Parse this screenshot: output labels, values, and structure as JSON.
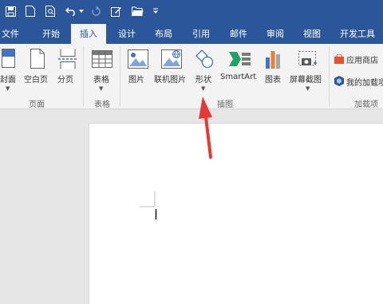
{
  "ribbon_tabs": [
    {
      "label": "文件"
    },
    {
      "label": "开始"
    },
    {
      "label": "插入"
    },
    {
      "label": "设计"
    },
    {
      "label": "布局"
    },
    {
      "label": "引用"
    },
    {
      "label": "邮件"
    },
    {
      "label": "审阅"
    },
    {
      "label": "视图"
    },
    {
      "label": "开发工具"
    }
  ],
  "active_tab": "插入",
  "groups": {
    "pages": {
      "label": "页面",
      "items": [
        {
          "label": "封面",
          "icon": "cover-page-icon"
        },
        {
          "label": "空白页",
          "icon": "blank-page-icon"
        },
        {
          "label": "分页",
          "icon": "page-break-icon"
        }
      ]
    },
    "tables": {
      "label": "表格",
      "items": [
        {
          "label": "表格",
          "icon": "table-icon"
        }
      ]
    },
    "illustrations": {
      "label": "插图",
      "items": [
        {
          "label": "图片",
          "icon": "picture-icon"
        },
        {
          "label": "联机图片",
          "icon": "online-picture-icon"
        },
        {
          "label": "形状",
          "icon": "shapes-icon"
        },
        {
          "label": "SmartArt",
          "icon": "smartart-icon"
        },
        {
          "label": "图表",
          "icon": "chart-icon"
        },
        {
          "label": "屏幕截图",
          "icon": "screenshot-icon"
        }
      ]
    },
    "addins": {
      "label": "加载项",
      "items": [
        {
          "label": "应用商店",
          "icon": "store-icon"
        },
        {
          "label": "我的加载项",
          "icon": "my-addins-icon"
        }
      ]
    }
  },
  "colors": {
    "title_bar": "#2b579a",
    "ribbon_bg": "#f3f3f3",
    "canvas_bg": "#e6e6e6",
    "annotation_arrow": "#e53935"
  }
}
